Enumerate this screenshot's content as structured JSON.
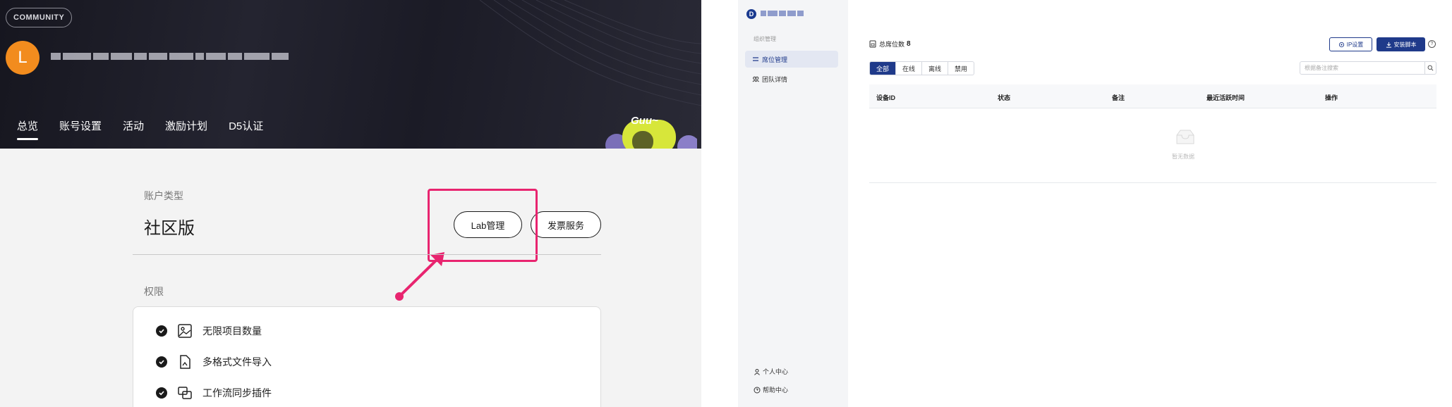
{
  "left": {
    "community_badge": "COMMUNITY",
    "avatar_letter": "L",
    "nav": [
      "总览",
      "账号设置",
      "活动",
      "激励计划",
      "D5认证"
    ],
    "mascot_text": "Guu~",
    "account": {
      "label": "账户类型",
      "type": "社区版",
      "lab_button": "Lab管理",
      "invoice_button": "发票服务"
    },
    "permissions": {
      "label": "权限",
      "items": [
        "无限项目数量",
        "多格式文件导入",
        "工作流同步插件"
      ]
    },
    "colors": {
      "highlight": "#e8246f",
      "avatar": "#f28c1e"
    }
  },
  "right": {
    "logo_letter": "D",
    "sidebar": {
      "section": "组织管理",
      "items": [
        "席位管理",
        "团队详情"
      ],
      "footer": [
        "个人中心",
        "帮助中心"
      ]
    },
    "total_label": "总席位数",
    "total_value": "8",
    "ip_button": "IP设置",
    "install_button": "安装脚本",
    "filters": [
      "全部",
      "在线",
      "离线",
      "禁用"
    ],
    "search_placeholder": "根据备注搜索",
    "columns": [
      "设备ID",
      "状态",
      "备注",
      "最近活跃时间",
      "操作"
    ],
    "empty_text": "暂无数据",
    "colors": {
      "primary": "#1f3a8a"
    }
  }
}
